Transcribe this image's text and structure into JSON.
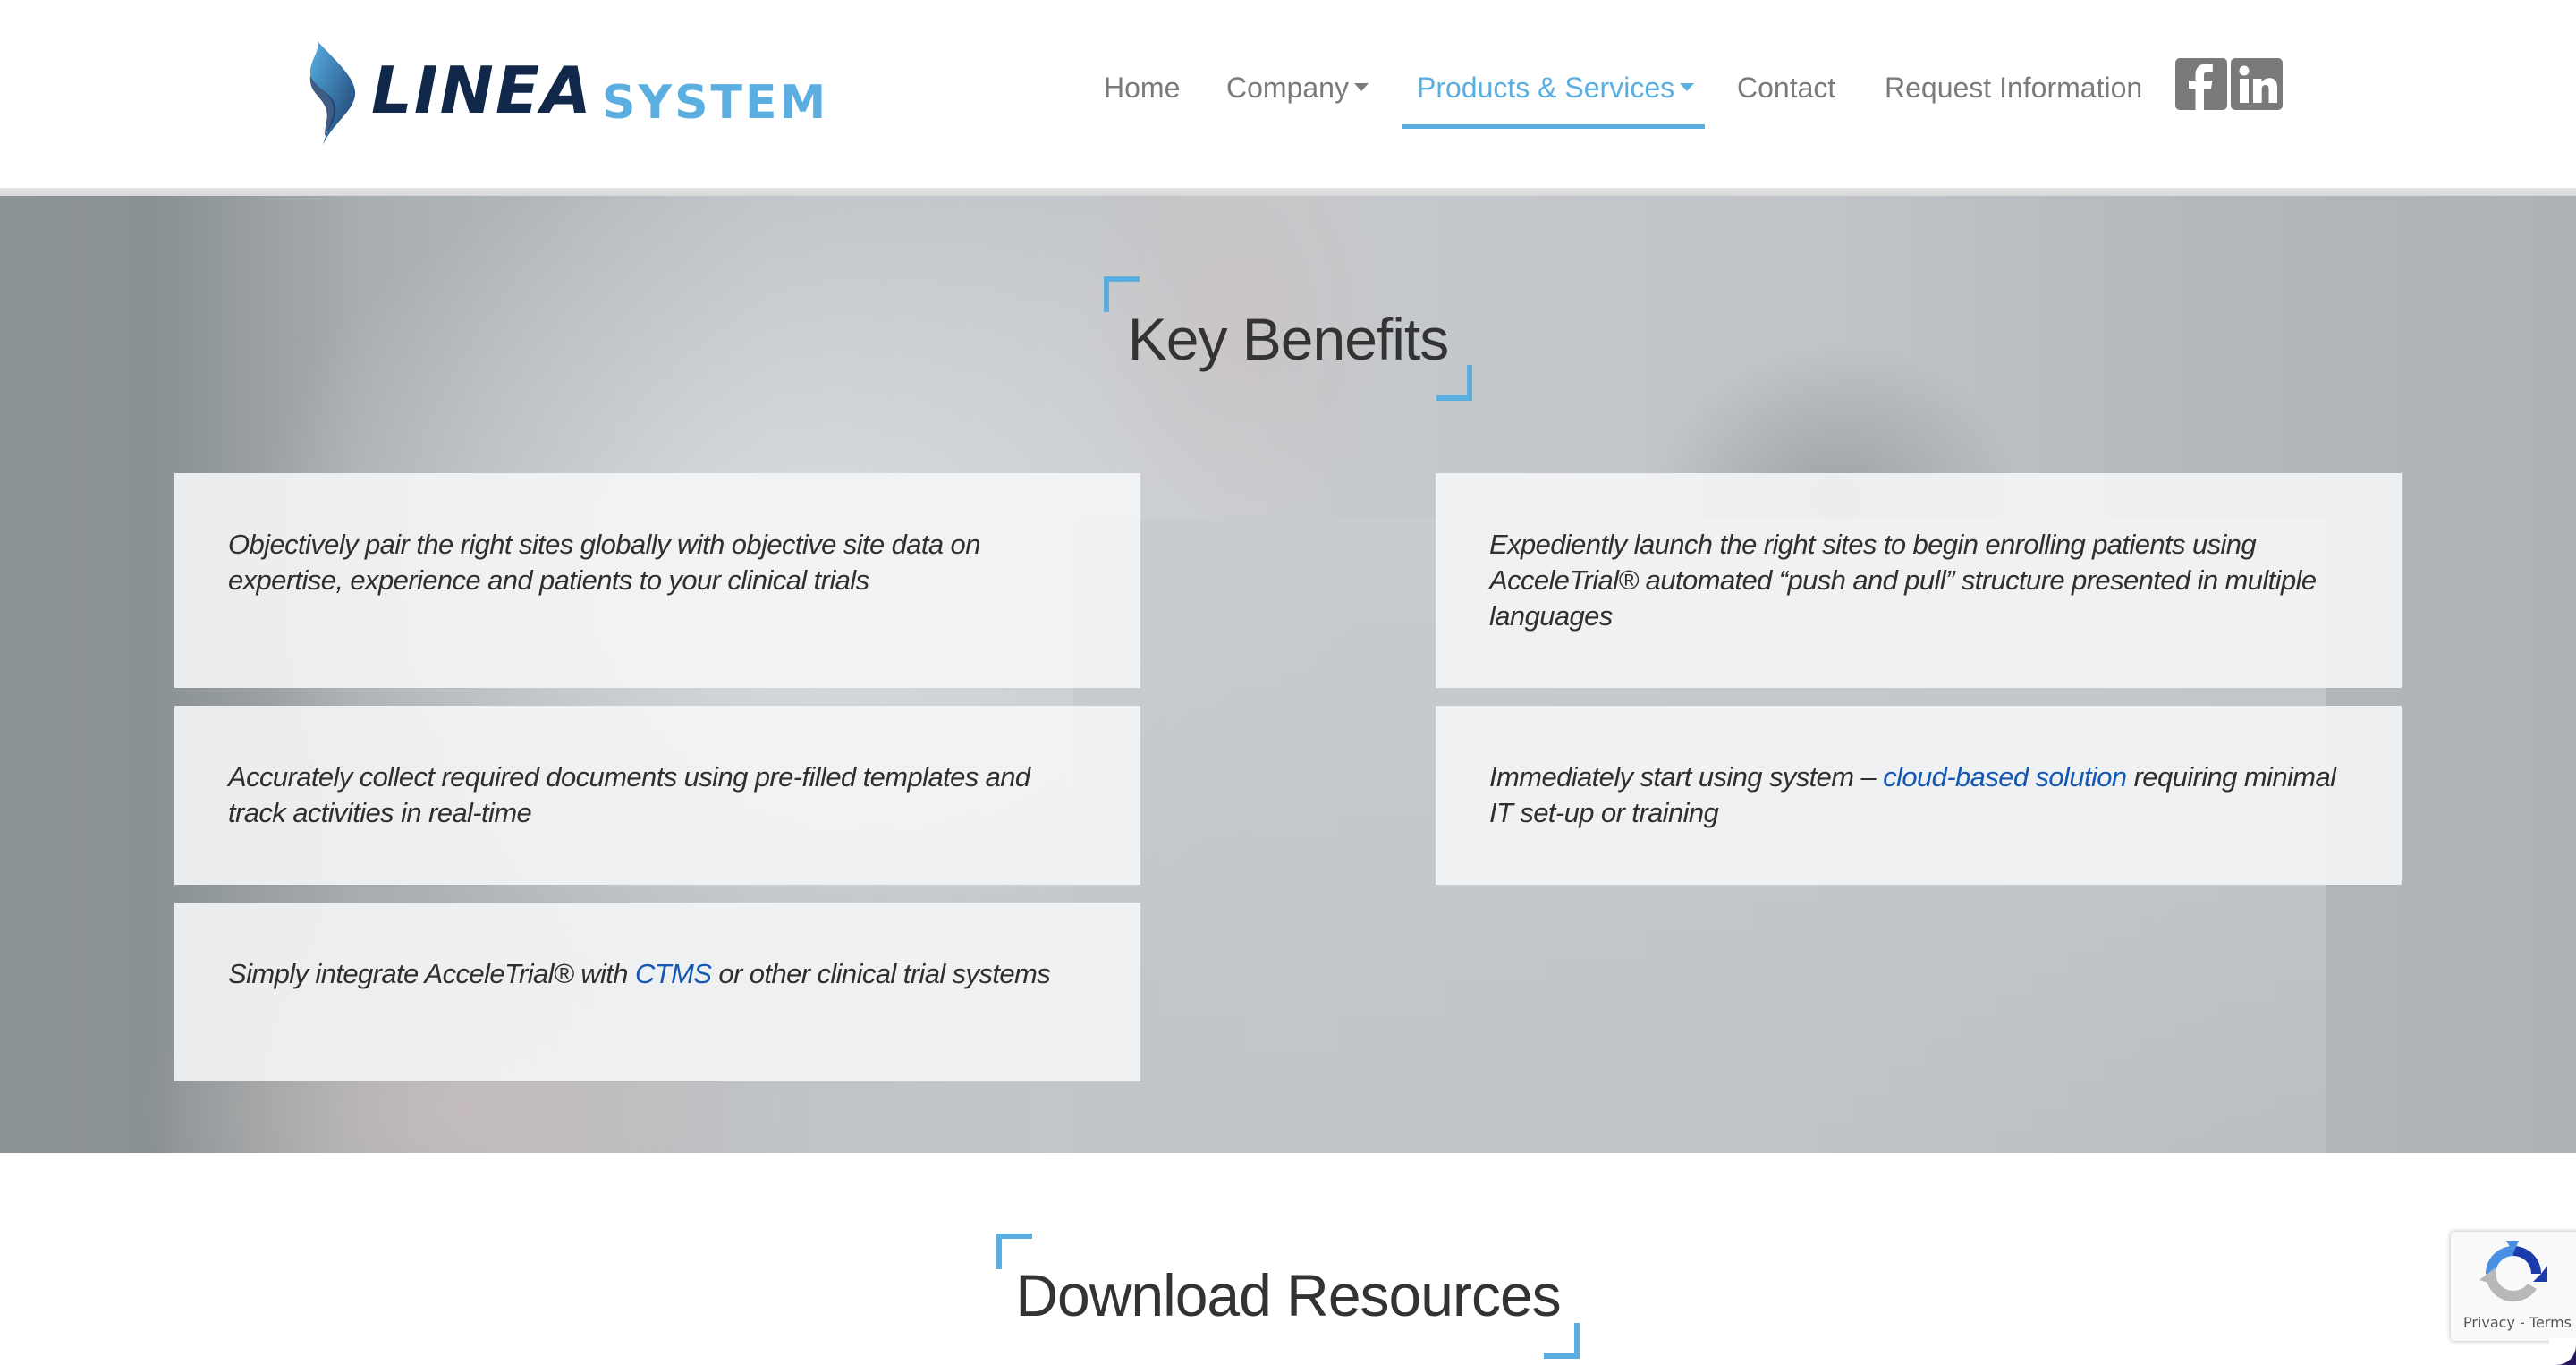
{
  "brand": {
    "logo_word_1": "LINEA",
    "logo_word_2": "SYSTEM",
    "colors": {
      "accent_blue": "#5aaee0",
      "logo_dark": "#12284a",
      "link_blue": "#1458b4",
      "nav_grey": "#7a7a7a",
      "heading_text": "#333333"
    }
  },
  "nav": {
    "items": [
      {
        "label": "Home",
        "has_dropdown": false,
        "active": false
      },
      {
        "label": "Company",
        "has_dropdown": true,
        "active": false
      },
      {
        "label": "Products & Services",
        "has_dropdown": true,
        "active": true
      },
      {
        "label": "Contact",
        "has_dropdown": false,
        "active": false
      },
      {
        "label": "Request Information",
        "has_dropdown": false,
        "active": false
      }
    ],
    "social": [
      {
        "icon": "facebook-icon",
        "label": "f"
      },
      {
        "icon": "linkedin-icon",
        "label": "in"
      }
    ]
  },
  "key_benefits": {
    "title": "Key Benefits",
    "cards": [
      {
        "text": "Objectively pair the right sites globally with objective site data on expertise, experience and patients to your clinical trials"
      },
      {
        "text": "Expediently launch the right sites to begin enrolling patients using AcceleTrial® automated “push and pull” structure presented in multiple languages"
      },
      {
        "text": "Accurately collect required documents using pre-filled templates and track activities in real-time"
      },
      {
        "text_before": "Immediately start using system – ",
        "link": "cloud-based solution",
        "text_after": " requiring minimal IT set-up or training"
      },
      {
        "text_before": "Simply integrate AcceleTrial® with ",
        "link": "CTMS",
        "text_after": " or other clinical trial systems"
      }
    ]
  },
  "download_resources": {
    "title": "Download Resources"
  },
  "recaptcha": {
    "privacy": "Privacy",
    "separator": " - ",
    "terms": "Terms"
  }
}
